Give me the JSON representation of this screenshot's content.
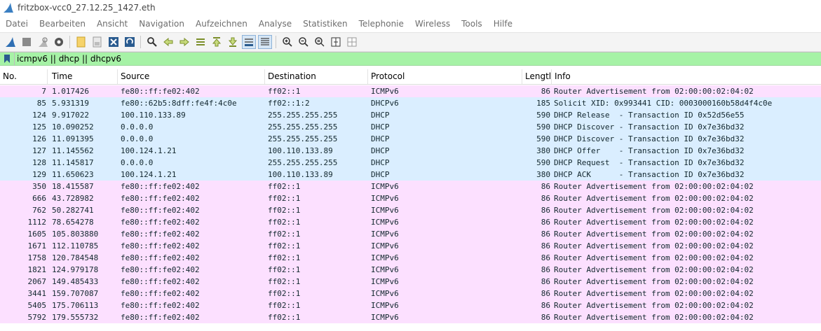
{
  "window": {
    "title": "fritzbox-vcc0_27.12.25_1427.eth"
  },
  "menu": [
    "Datei",
    "Bearbeiten",
    "Ansicht",
    "Navigation",
    "Aufzeichnen",
    "Analyse",
    "Statistiken",
    "Telephonie",
    "Wireless",
    "Tools",
    "Hilfe"
  ],
  "filter": {
    "value": "icmpv6 || dhcp || dhcpv6"
  },
  "columns": [
    "No.",
    "Time",
    "Source",
    "Destination",
    "Protocol",
    "Lengtl",
    "Info"
  ],
  "colors": {
    "icmpv6_bg": "#fce0ff",
    "dhcp_bg": "#daeeff",
    "filter_bg": "#a6f2a6",
    "text": "#12272e"
  },
  "packets": [
    {
      "no": "7",
      "time": "1.017426",
      "source": "fe80::ff:fe02:402",
      "destination": "ff02::1",
      "protocol": "ICMPv6",
      "length": "86",
      "info": "Router Advertisement from 02:00:00:02:04:02"
    },
    {
      "no": "85",
      "time": "5.931319",
      "source": "fe80::62b5:8dff:fe4f:4c0e",
      "destination": "ff02::1:2",
      "protocol": "DHCPv6",
      "length": "185",
      "info": "Solicit XID: 0x993441 CID: 0003000160b58d4f4c0e"
    },
    {
      "no": "124",
      "time": "9.917022",
      "source": "100.110.133.89",
      "destination": "255.255.255.255",
      "protocol": "DHCP",
      "length": "590",
      "info": "DHCP Release  - Transaction ID 0x52d56e55"
    },
    {
      "no": "125",
      "time": "10.090252",
      "source": "0.0.0.0",
      "destination": "255.255.255.255",
      "protocol": "DHCP",
      "length": "590",
      "info": "DHCP Discover - Transaction ID 0x7e36bd32"
    },
    {
      "no": "126",
      "time": "11.091395",
      "source": "0.0.0.0",
      "destination": "255.255.255.255",
      "protocol": "DHCP",
      "length": "590",
      "info": "DHCP Discover - Transaction ID 0x7e36bd32"
    },
    {
      "no": "127",
      "time": "11.145562",
      "source": "100.124.1.21",
      "destination": "100.110.133.89",
      "protocol": "DHCP",
      "length": "380",
      "info": "DHCP Offer    - Transaction ID 0x7e36bd32"
    },
    {
      "no": "128",
      "time": "11.145817",
      "source": "0.0.0.0",
      "destination": "255.255.255.255",
      "protocol": "DHCP",
      "length": "590",
      "info": "DHCP Request  - Transaction ID 0x7e36bd32"
    },
    {
      "no": "129",
      "time": "11.650623",
      "source": "100.124.1.21",
      "destination": "100.110.133.89",
      "protocol": "DHCP",
      "length": "380",
      "info": "DHCP ACK      - Transaction ID 0x7e36bd32"
    },
    {
      "no": "350",
      "time": "18.415587",
      "source": "fe80::ff:fe02:402",
      "destination": "ff02::1",
      "protocol": "ICMPv6",
      "length": "86",
      "info": "Router Advertisement from 02:00:00:02:04:02"
    },
    {
      "no": "666",
      "time": "43.728982",
      "source": "fe80::ff:fe02:402",
      "destination": "ff02::1",
      "protocol": "ICMPv6",
      "length": "86",
      "info": "Router Advertisement from 02:00:00:02:04:02"
    },
    {
      "no": "762",
      "time": "50.282741",
      "source": "fe80::ff:fe02:402",
      "destination": "ff02::1",
      "protocol": "ICMPv6",
      "length": "86",
      "info": "Router Advertisement from 02:00:00:02:04:02"
    },
    {
      "no": "1112",
      "time": "78.654278",
      "source": "fe80::ff:fe02:402",
      "destination": "ff02::1",
      "protocol": "ICMPv6",
      "length": "86",
      "info": "Router Advertisement from 02:00:00:02:04:02"
    },
    {
      "no": "1605",
      "time": "105.803880",
      "source": "fe80::ff:fe02:402",
      "destination": "ff02::1",
      "protocol": "ICMPv6",
      "length": "86",
      "info": "Router Advertisement from 02:00:00:02:04:02"
    },
    {
      "no": "1671",
      "time": "112.110785",
      "source": "fe80::ff:fe02:402",
      "destination": "ff02::1",
      "protocol": "ICMPv6",
      "length": "86",
      "info": "Router Advertisement from 02:00:00:02:04:02"
    },
    {
      "no": "1758",
      "time": "120.784548",
      "source": "fe80::ff:fe02:402",
      "destination": "ff02::1",
      "protocol": "ICMPv6",
      "length": "86",
      "info": "Router Advertisement from 02:00:00:02:04:02"
    },
    {
      "no": "1821",
      "time": "124.979178",
      "source": "fe80::ff:fe02:402",
      "destination": "ff02::1",
      "protocol": "ICMPv6",
      "length": "86",
      "info": "Router Advertisement from 02:00:00:02:04:02"
    },
    {
      "no": "2067",
      "time": "149.485433",
      "source": "fe80::ff:fe02:402",
      "destination": "ff02::1",
      "protocol": "ICMPv6",
      "length": "86",
      "info": "Router Advertisement from 02:00:00:02:04:02"
    },
    {
      "no": "3441",
      "time": "159.707087",
      "source": "fe80::ff:fe02:402",
      "destination": "ff02::1",
      "protocol": "ICMPv6",
      "length": "86",
      "info": "Router Advertisement from 02:00:00:02:04:02"
    },
    {
      "no": "5405",
      "time": "175.706113",
      "source": "fe80::ff:fe02:402",
      "destination": "ff02::1",
      "protocol": "ICMPv6",
      "length": "86",
      "info": "Router Advertisement from 02:00:00:02:04:02"
    },
    {
      "no": "5792",
      "time": "179.555732",
      "source": "fe80::ff:fe02:402",
      "destination": "ff02::1",
      "protocol": "ICMPv6",
      "length": "86",
      "info": "Router Advertisement from 02:00:00:02:04:02"
    }
  ]
}
